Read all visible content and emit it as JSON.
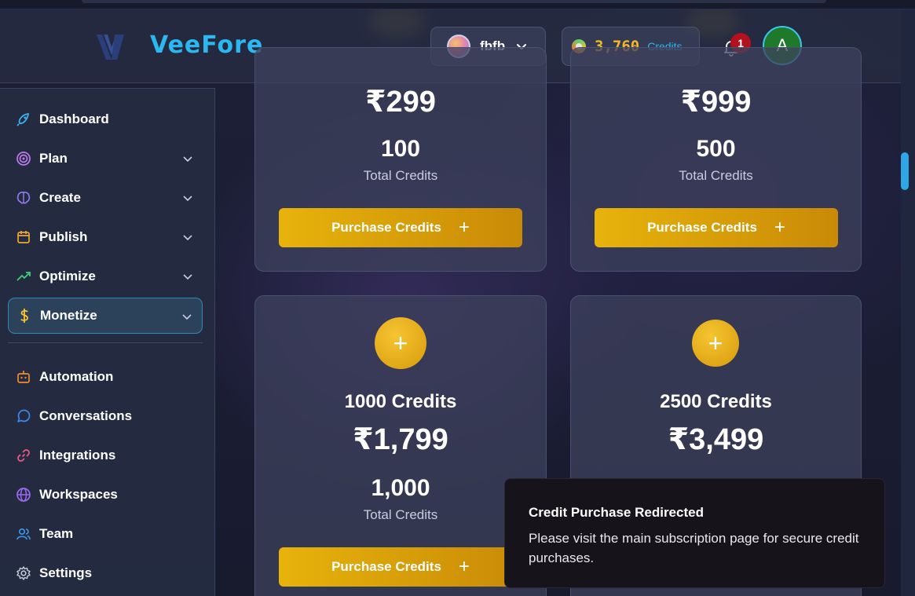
{
  "brand": {
    "name": "VeeFore"
  },
  "header": {
    "workspace_name": "fbfb",
    "credits_amount": "3,760",
    "credits_label": "Credits",
    "notification_count": "1",
    "avatar_initial": "A"
  },
  "sidebar": {
    "items": [
      {
        "label": "Dashboard",
        "icon": "rocket-icon"
      },
      {
        "label": "Plan",
        "icon": "target-icon"
      },
      {
        "label": "Create",
        "icon": "brain-icon"
      },
      {
        "label": "Publish",
        "icon": "calendar-icon"
      },
      {
        "label": "Optimize",
        "icon": "trending-up-icon"
      },
      {
        "label": "Monetize",
        "icon": "dollar-icon"
      },
      {
        "label": "Automation",
        "icon": "bot-icon"
      },
      {
        "label": "Conversations",
        "icon": "chat-icon"
      },
      {
        "label": "Integrations",
        "icon": "link-icon"
      },
      {
        "label": "Workspaces",
        "icon": "globe-icon"
      },
      {
        "label": "Team",
        "icon": "users-icon"
      },
      {
        "label": "Settings",
        "icon": "gear-icon"
      }
    ],
    "active": "Monetize"
  },
  "packages": [
    {
      "price": "₹299",
      "credits": "100",
      "credits_label": "Total Credits",
      "button": "Purchase Credits"
    },
    {
      "price": "₹999",
      "credits": "500",
      "credits_label": "Total Credits",
      "button": "Purchase Credits"
    },
    {
      "title": "1000 Credits",
      "price": "₹1,799",
      "credits": "1,000",
      "credits_label": "Total Credits",
      "button": "Purchase Credits"
    },
    {
      "title": "2500 Credits",
      "price": "₹3,499"
    }
  ],
  "toast": {
    "title": "Credit Purchase Redirected",
    "body": "Please visit the main subscription page for secure credit purchases."
  },
  "colors": {
    "accent": "#2bb8f0",
    "gold": "#e7b30b",
    "badge": "#b3111e"
  }
}
